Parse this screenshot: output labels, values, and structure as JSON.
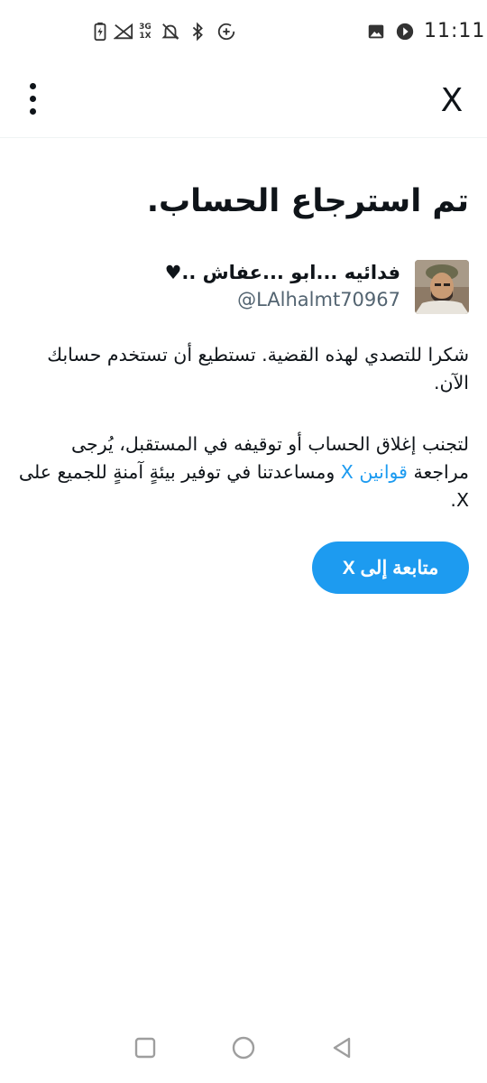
{
  "status_bar": {
    "time": "11:11",
    "icons": [
      "gallery-icon",
      "play-icon",
      "battery-charging-icon",
      "signal-icon",
      "network-3g-icon",
      "notifications-off-icon",
      "bluetooth-icon",
      "data-saver-icon"
    ],
    "network_label_top": "3G",
    "network_label_bottom": "1X"
  },
  "app_bar": {
    "logo": "X",
    "icons": [
      "close-icon",
      "more-vertical-icon"
    ]
  },
  "main": {
    "title": "تم استرجاع الحساب.",
    "profile": {
      "display_name": "فدائيه ...ابو ...عفاش ..♥",
      "handle": "@LAlhalmt70967"
    },
    "paragraph_1": "شكرا للتصدي لهذه القضية. تستطيع أن تستخدم حسابك الآن.",
    "paragraph_2_before": "لتجنب إغلاق الحساب أو توقيفه في المستقبل، يُرجى مراجعة ",
    "rules_link": "قوانين X",
    "paragraph_2_after": " ومساعدتنا في توفير بيئةٍ آمنةٍ للجميع على X.",
    "continue_button": "متابعة إلى X"
  },
  "nav_bar": {
    "icons": [
      "recents-icon",
      "home-icon",
      "back-icon"
    ]
  },
  "colors": {
    "accent": "#1d9bf0",
    "text_primary": "#0f1419",
    "text_secondary": "#536471",
    "divider": "#eff3f4"
  }
}
